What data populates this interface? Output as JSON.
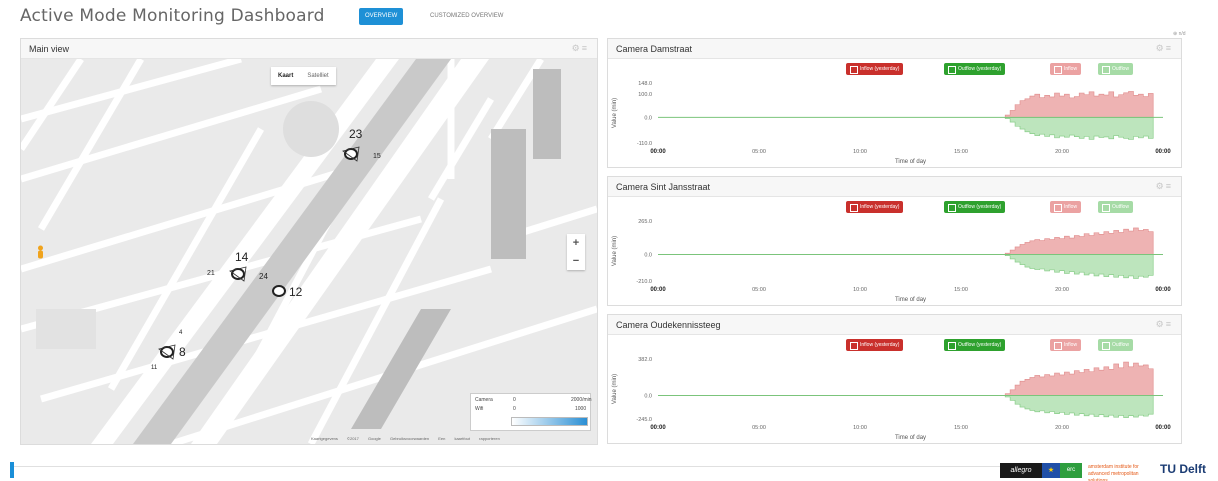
{
  "header": {
    "title": "Active Mode Monitoring Dashboard",
    "tabs": [
      {
        "label": "OVERVIEW",
        "active": true
      },
      {
        "label": "CUSTOMIZED OVERVIEW",
        "active": false
      }
    ],
    "accent_color": "#1e90d6"
  },
  "map_panel": {
    "title": "Main view",
    "map_types": [
      "Kaart",
      "Satelliet"
    ],
    "zoom": {
      "in": "+",
      "out": "−"
    },
    "legend": {
      "rows": [
        {
          "label": "Camera",
          "min": "0",
          "max": "2000/min"
        },
        {
          "label": "Wifi",
          "min": "0",
          "max": "1000"
        }
      ],
      "gradient_colors": [
        "#ffffff",
        "#2b8fd4"
      ]
    },
    "attribution": "Kaartgegevens ©2017 Google Gebruiksvoorwaarden Een kaartfout rapporteren",
    "cameras": [
      {
        "count": "23",
        "side_left": "",
        "side_right": "15",
        "icon": "camera-icon"
      },
      {
        "count": "14",
        "side_left": "21",
        "side_right": "24",
        "icon": "camera-icon"
      },
      {
        "count": "12",
        "side_left": "",
        "side_right": "",
        "icon": "camera-icon"
      },
      {
        "count": "8",
        "side_left": "4",
        "side_right": "11",
        "icon": "camera-icon"
      }
    ]
  },
  "camera_panels": [
    {
      "title": "Camera Damstraat",
      "ymax": "148.0",
      "ymid": "0.0",
      "ymin": "-110.0",
      "y_inner": "100.0"
    },
    {
      "title": "Camera Sint Jansstraat",
      "ymax": "265.0",
      "ymid": "0.0",
      "ymin": "-210.0",
      "y_inner": ""
    },
    {
      "title": "Camera Oudekennissteeg",
      "ymax": "382.0",
      "ymid": "0.0",
      "ymin": "-245.0",
      "y_inner": ""
    }
  ],
  "chart_legend": {
    "inflow_yesterday": "Inflow (yesterday)",
    "outflow_yesterday": "Outflow (yesterday)",
    "inflow": "Inflow",
    "outflow": "Outflow"
  },
  "chart_axes": {
    "ylabel": "Value (min)",
    "xlabel": "Time of day",
    "xticks": [
      "00:00",
      "05:00",
      "10:00",
      "15:00",
      "20:00",
      "00:00"
    ]
  },
  "chart_colors": {
    "inflow_fill": "#eeb3b3",
    "inflow_line": "#e08a8a",
    "outflow_fill": "#bde5bd",
    "outflow_line": "#7fc97f",
    "zero_line": "#7bc47b"
  },
  "chart_data": [
    {
      "type": "area",
      "title": "Camera Damstraat",
      "xlabel": "Time of day",
      "ylabel": "Value (min)",
      "xlim": [
        "00:00",
        "24:00"
      ],
      "ylim": [
        -110,
        148
      ],
      "x_start_hour": 16.5,
      "x_end_hour": 23.3,
      "series": [
        {
          "name": "Inflow",
          "values": [
            10,
            30,
            55,
            72,
            80,
            92,
            100,
            85,
            95,
            88,
            105,
            92,
            100,
            84,
            90,
            105,
            98,
            110,
            92,
            100,
            96,
            110,
            88,
            98,
            106,
            112,
            95,
            100,
            90,
            103
          ]
        },
        {
          "name": "Outflow",
          "values": [
            -5,
            -20,
            -38,
            -50,
            -62,
            -70,
            -78,
            -72,
            -82,
            -75,
            -88,
            -80,
            -85,
            -76,
            -83,
            -90,
            -82,
            -94,
            -80,
            -86,
            -84,
            -92,
            -78,
            -85,
            -90,
            -95,
            -82,
            -88,
            -80,
            -90
          ]
        }
      ]
    },
    {
      "type": "area",
      "title": "Camera Sint Jansstraat",
      "xlabel": "Time of day",
      "ylabel": "Value (min)",
      "xlim": [
        "00:00",
        "24:00"
      ],
      "ylim": [
        -210,
        265
      ],
      "x_start_hour": 16.5,
      "x_end_hour": 23.3,
      "series": [
        {
          "name": "Inflow",
          "values": [
            10,
            35,
            60,
            80,
            95,
            108,
            118,
            110,
            125,
            118,
            135,
            125,
            145,
            130,
            150,
            142,
            165,
            150,
            172,
            160,
            180,
            168,
            190,
            175,
            200,
            185,
            210,
            190,
            198,
            180
          ]
        },
        {
          "name": "Outflow",
          "values": [
            -10,
            -35,
            -60,
            -80,
            -100,
            -112,
            -120,
            -115,
            -130,
            -122,
            -140,
            -128,
            -150,
            -135,
            -155,
            -140,
            -162,
            -148,
            -170,
            -155,
            -175,
            -160,
            -180,
            -165,
            -185,
            -170,
            -190,
            -172,
            -180,
            -165
          ]
        }
      ]
    },
    {
      "type": "area",
      "title": "Camera Oudekennissteeg",
      "xlabel": "Time of day",
      "ylabel": "Value (min)",
      "xlim": [
        "00:00",
        "24:00"
      ],
      "ylim": [
        -245,
        382
      ],
      "x_start_hour": 16.5,
      "x_end_hour": 23.3,
      "series": [
        {
          "name": "Inflow",
          "values": [
            20,
            60,
            110,
            150,
            170,
            190,
            210,
            195,
            220,
            205,
            235,
            215,
            245,
            225,
            260,
            240,
            275,
            250,
            290,
            265,
            300,
            275,
            330,
            290,
            350,
            300,
            340,
            310,
            320,
            280
          ]
        },
        {
          "name": "Outflow",
          "values": [
            -15,
            -50,
            -90,
            -120,
            -140,
            -155,
            -170,
            -160,
            -180,
            -168,
            -190,
            -175,
            -198,
            -182,
            -205,
            -190,
            -212,
            -195,
            -218,
            -200,
            -222,
            -205,
            -226,
            -208,
            -230,
            -210,
            -225,
            -205,
            -215,
            -195
          ]
        }
      ]
    }
  ],
  "footer": {
    "logos": [
      "allegro",
      "EU",
      "erc",
      "amsterdam institute for advanced metropolitan solutions",
      "TU Delft"
    ],
    "allegro_label": "allegro",
    "eu_label": "★",
    "erc_label": "erc",
    "ams_label": "amsterdam institute for advanced metropolitan solutions",
    "tud_label": "TU Delft"
  },
  "corner_note": "⊕ n/d"
}
